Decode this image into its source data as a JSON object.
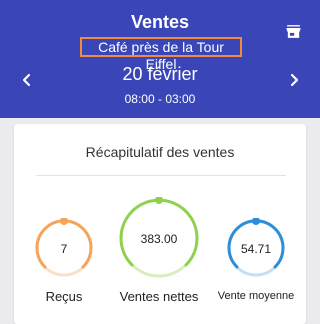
{
  "header": {
    "title": "Ventes",
    "store_name": "Café près de la Tour Eiffel",
    "date": "20 février",
    "hours": "08:00 - 03:00",
    "store_icon": "store-icon",
    "prev_icon": "chevron-left-icon",
    "next_icon": "chevron-right-icon"
  },
  "summary": {
    "title": "Récapitulatif des ventes",
    "metrics": [
      {
        "value": "7",
        "label": "Reçus",
        "color": "#f5a45a"
      },
      {
        "value": "383.00",
        "label": "Ventes nettes",
        "color": "#8fd14f"
      },
      {
        "value": "54.71",
        "label": "Vente moyenne",
        "color": "#2e8fd6"
      }
    ]
  },
  "colors": {
    "header_bg": "#3a46b8",
    "highlight_border": "#ef8b3b",
    "page_bg": "#ececf0"
  }
}
